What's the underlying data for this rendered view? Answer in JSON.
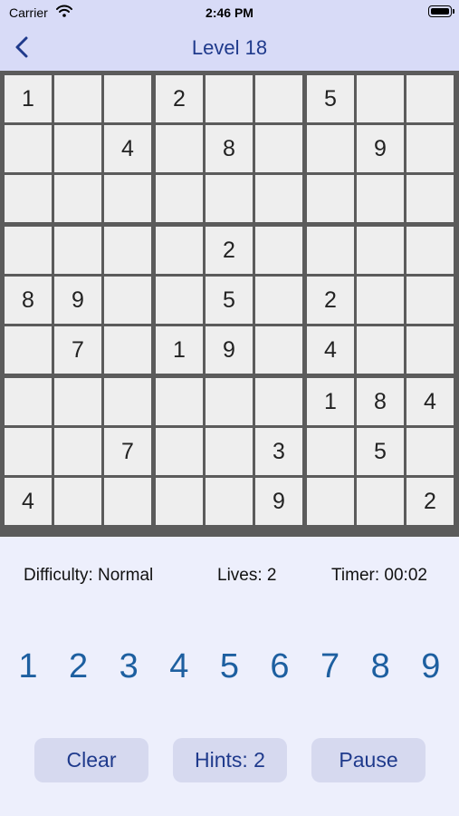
{
  "status_bar": {
    "carrier": "Carrier",
    "time": "2:46 PM"
  },
  "nav": {
    "title": "Level 18"
  },
  "board": [
    [
      "1",
      "",
      "",
      "2",
      "",
      "",
      "5",
      "",
      ""
    ],
    [
      "",
      "",
      "4",
      "",
      "8",
      "",
      "",
      "9",
      ""
    ],
    [
      "",
      "",
      "",
      "",
      "",
      "",
      "",
      "",
      ""
    ],
    [
      "",
      "",
      "",
      "",
      "2",
      "",
      "",
      "",
      ""
    ],
    [
      "8",
      "9",
      "",
      "",
      "5",
      "",
      "2",
      "",
      ""
    ],
    [
      "",
      "7",
      "",
      "1",
      "9",
      "",
      "4",
      "",
      ""
    ],
    [
      "",
      "",
      "",
      "",
      "",
      "",
      "1",
      "8",
      "4"
    ],
    [
      "",
      "",
      "7",
      "",
      "",
      "3",
      "",
      "5",
      ""
    ],
    [
      "4",
      "",
      "",
      "",
      "",
      "9",
      "",
      "",
      "2"
    ]
  ],
  "info": {
    "difficulty": "Difficulty: Normal",
    "lives": "Lives: 2",
    "timer": "Timer: 00:02"
  },
  "numpad": [
    "1",
    "2",
    "3",
    "4",
    "5",
    "6",
    "7",
    "8",
    "9"
  ],
  "buttons": {
    "clear": "Clear",
    "hints": "Hints: 2",
    "pause": "Pause"
  },
  "colors": {
    "accent": "#1f3a8c",
    "number": "#1d5fa0",
    "header_bg": "#d8dbf7",
    "grid_line": "#5b5b5b",
    "cell_bg": "#eeeeee"
  }
}
